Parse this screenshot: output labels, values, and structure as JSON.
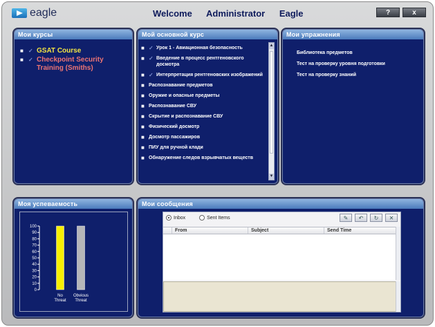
{
  "app": {
    "logo": "eagle",
    "welcome_word": "Welcome",
    "user_role": "Administrator",
    "user_name": "Eagle",
    "help_btn": "?",
    "close_btn": "x"
  },
  "panels": {
    "courses": {
      "title": "Мои курсы"
    },
    "main_course": {
      "title": "Мой основной курс"
    },
    "exercises": {
      "title": "Мои упражнения"
    },
    "progress": {
      "title": "Моя успеваемость"
    },
    "messages": {
      "title": "Мои сообщения"
    }
  },
  "courses": [
    {
      "label": "GSAT Course",
      "color": "#f3e443"
    },
    {
      "label": "Checkpoint Security Training (Smiths)",
      "color": "#ec7474"
    }
  ],
  "lessons": [
    "Урок 1 - Авиационная безопасность",
    "Введение в процесс рентгеновского досмотра",
    "Интерпретация рентгеновских изображений",
    "Распознавание предметов",
    "Оружие и опасные предметы",
    "Распознавание СВУ",
    "Скрытие и распознавание СВУ",
    "Физический досмотр",
    "Досмотр пассажиров",
    "ПИУ для ручной клади",
    "Обнаружение следов взрывчатых веществ"
  ],
  "exercises": [
    "Библиотека предметов",
    "Тест на проверку уровня подготовки",
    "Тест на проверку знаний"
  ],
  "messages": {
    "inbox_label": "Inbox",
    "sent_label": "Sent Items",
    "columns": [
      "From",
      "Subject",
      "Send Time"
    ]
  },
  "chart_data": {
    "type": "bar",
    "categories": [
      "No Threat",
      "Obvious Threat"
    ],
    "values": [
      100,
      100
    ],
    "colors": [
      "#f7f000",
      "#b5b6b9"
    ],
    "ylim": [
      0,
      100
    ],
    "yticks": [
      0,
      10,
      20,
      30,
      40,
      50,
      60,
      70,
      80,
      90,
      100
    ],
    "grid": false
  }
}
